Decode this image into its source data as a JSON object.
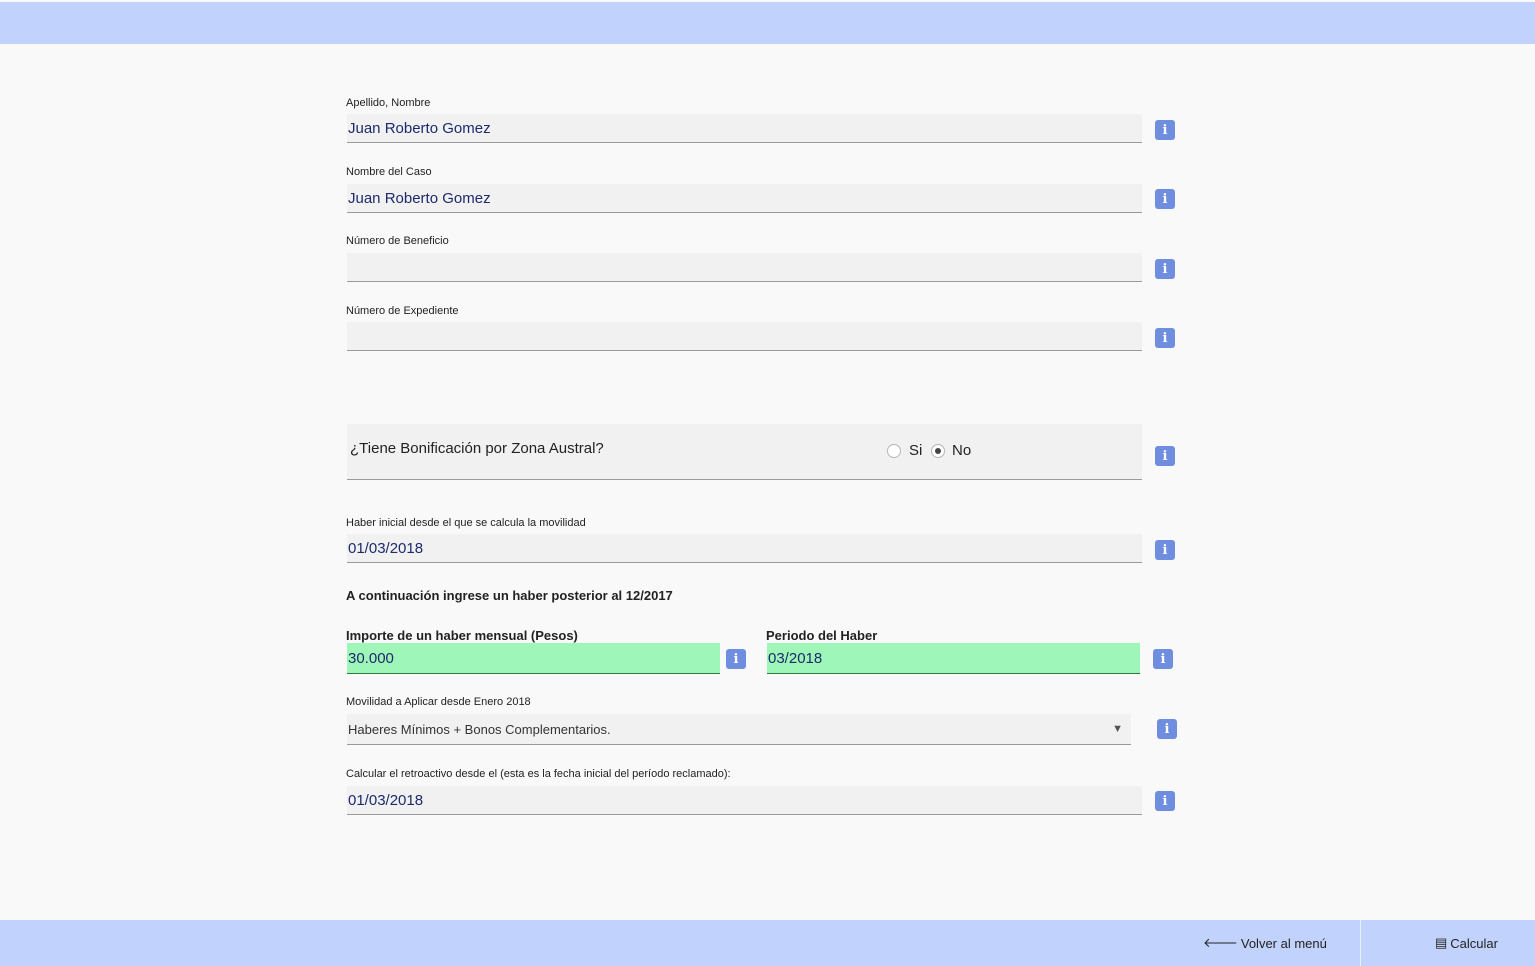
{
  "form": {
    "apellido_nombre": {
      "label": "Apellido, Nombre",
      "value": "Juan Roberto Gomez"
    },
    "nombre_caso": {
      "label": "Nombre del Caso",
      "value": "Juan Roberto Gomez"
    },
    "numero_beneficio": {
      "label": "Número de Beneficio",
      "value": ""
    },
    "numero_expediente": {
      "label": "Número de Expediente",
      "value": ""
    },
    "zona_austral": {
      "question": "¿Tiene Bonificación por Zona Austral?",
      "option_si": "Si",
      "option_no": "No",
      "selected": "No"
    },
    "haber_inicial": {
      "label": "Haber inicial desde el que se calcula la movilidad",
      "value": "01/03/2018"
    },
    "section_heading": "A continuación ingrese un haber posterior al 12/2017",
    "importe": {
      "label": "Importe de un haber mensual (Pesos)",
      "value": "30.000"
    },
    "periodo": {
      "label": "Periodo del Haber",
      "value": "03/2018"
    },
    "movilidad": {
      "label": "Movilidad a Aplicar desde Enero 2018",
      "selected": "Haberes Mínimos + Bonos Complementarios."
    },
    "retroactivo": {
      "label": "Calcular el retroactivo desde el (esta es la fecha inicial del período reclamado):",
      "value": "01/03/2018"
    }
  },
  "footer": {
    "back_label": "Volver al menú",
    "calc_label": "Calcular"
  },
  "icons": {
    "info": "info-icon",
    "back": "arrow-left-icon",
    "calc": "calculator-icon"
  },
  "colors": {
    "bar": "#c1d3fc",
    "info_button": "#6f8ee0",
    "highlight_field": "#9ef7b8"
  }
}
